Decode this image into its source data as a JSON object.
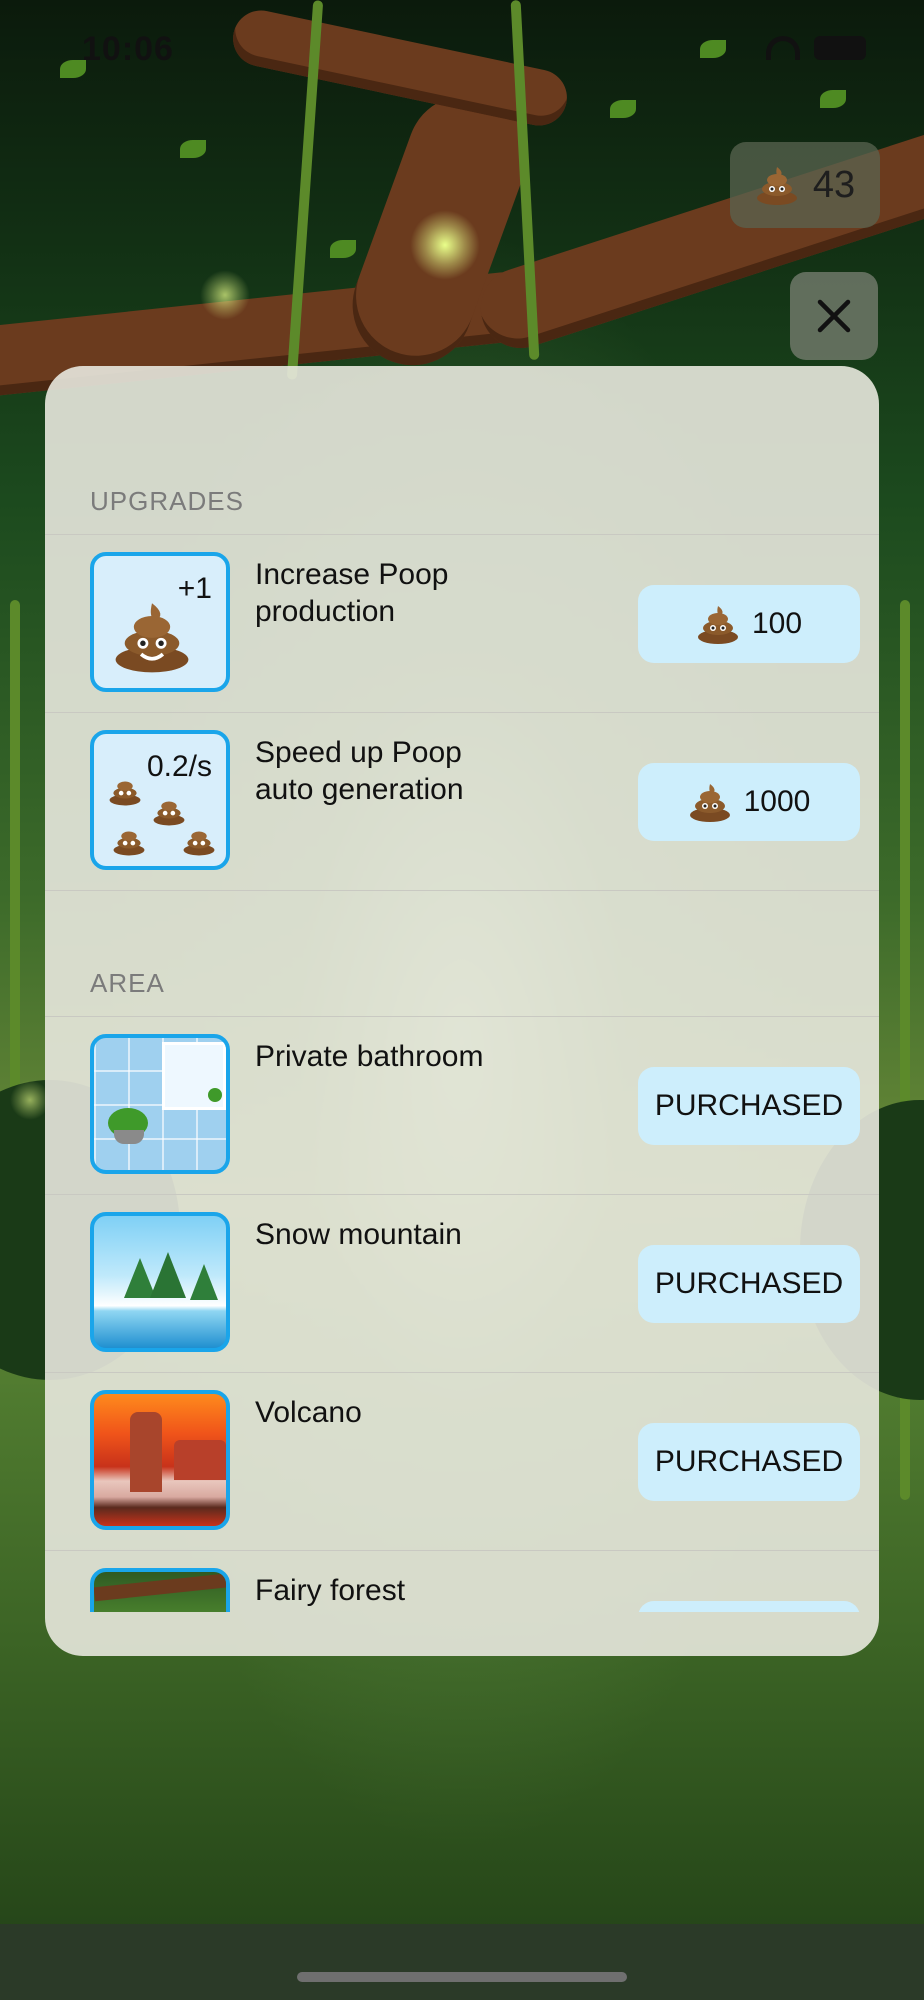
{
  "status": {
    "time": "10:06"
  },
  "header": {
    "poop_count": "43"
  },
  "upgrades": {
    "header": "UPGRADES",
    "items": [
      {
        "title": "Increase Poop production",
        "badge": "+1",
        "price": "100"
      },
      {
        "title": "Speed up Poop auto generation",
        "badge": "0.2/s",
        "price": "1000"
      }
    ]
  },
  "area": {
    "header": "AREA",
    "items": [
      {
        "title": "Private bathroom",
        "button": "PURCHASED"
      },
      {
        "title": "Snow mountain",
        "button": "PURCHASED"
      },
      {
        "title": "Volcano",
        "button": "PURCHASED"
      },
      {
        "title": "Fairy forest",
        "button": ""
      }
    ]
  },
  "colors": {
    "accent": "#1aa5ea",
    "button_bg": "#cdeefc",
    "modal_bg": "#e8e8de"
  },
  "icons": {
    "currency": "poop-icon",
    "close": "close-icon"
  }
}
